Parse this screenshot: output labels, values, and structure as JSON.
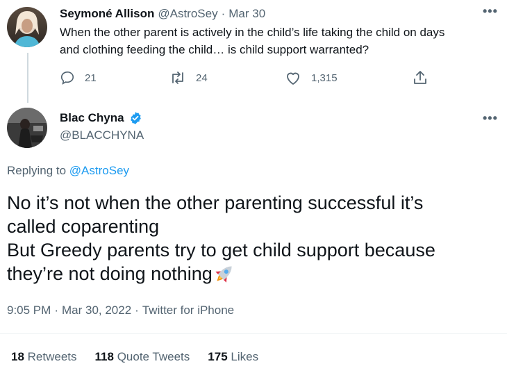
{
  "parent_tweet": {
    "author_name": "Seymoné Allison",
    "author_handle": "@AstroSey",
    "separator": "·",
    "date": "Mar 30",
    "text_line1": "When the other parent is actively in the child’s life taking the child on days",
    "text_line2": "and clothing feeding the child… is child support warranted?",
    "replies": "21",
    "retweets": "24",
    "likes": "1,315",
    "more_icon": "more-horizontal-icon"
  },
  "main_tweet": {
    "author_name": "Blac Chyna",
    "author_handle": "@BLACCHYNA",
    "verified_icon": "verified-badge-icon",
    "replying_prefix": "Replying to",
    "replying_handle": "@AstroSey",
    "text_line1": "No it’s not when the other parenting successful it’s",
    "text_line2": "called coparenting",
    "text_line3": "But Greedy parents try to get child support because",
    "text_line4": "they’re not doing nothing",
    "emoji_icon": "rocket-emoji-icon",
    "time": "9:05 PM",
    "separator": "·",
    "date": "Mar 30, 2022",
    "source": "Twitter for iPhone",
    "more_icon": "more-horizontal-icon"
  },
  "stats": {
    "retweets_count": "18",
    "retweets_label": "Retweets",
    "quotes_count": "118",
    "quotes_label": "Quote Tweets",
    "likes_count": "175",
    "likes_label": "Likes"
  },
  "colors": {
    "accent": "#1d9bf0",
    "text_primary": "#0f1419",
    "text_secondary": "#536471",
    "divider": "#eff3f4"
  }
}
